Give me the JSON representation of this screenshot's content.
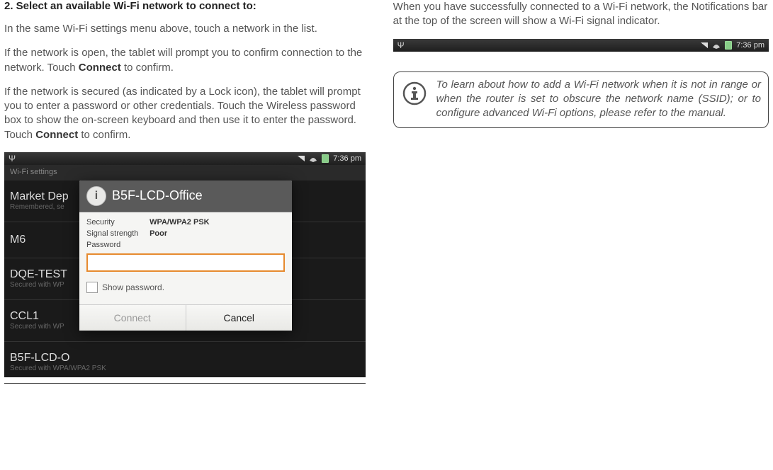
{
  "left": {
    "heading": "2.   Select an available Wi-Fi network to connect to:",
    "p1": "In the same Wi-Fi settings menu above, touch a network in the list.",
    "p2a": "If the network is open, the tablet will prompt you to confirm connection to the network. Touch ",
    "p2bold1": "Connect",
    "p2b": " to confirm.",
    "p3a": "If the network is secured (as indicated by a Lock icon), the tablet will prompt you to enter a password or other credentials.  Touch the Wireless password box to show the on-screen keyboard and then use it to enter the password. Touch ",
    "p3bold": "Connect",
    "p3b": " to confirm."
  },
  "screenshot": {
    "time": "7:36 pm",
    "wifi_settings_label": "Wi-Fi settings",
    "networks": [
      {
        "name": "Market Dep",
        "sub": "Remembered, se"
      },
      {
        "name": "M6",
        "sub": ""
      },
      {
        "name": "DQE-TEST",
        "sub": "Secured with WP"
      },
      {
        "name": "CCL1",
        "sub": "Secured with WP"
      },
      {
        "name": "B5F-LCD-O",
        "sub": "Secured with WPA/WPA2 PSK"
      }
    ],
    "dialog": {
      "title": "B5F-LCD-Office",
      "security_label": "Security",
      "security_value": "WPA/WPA2 PSK",
      "signal_label": "Signal strength",
      "signal_value": "Poor",
      "password_label": "Password",
      "show_pw": "Show password.",
      "connect": "Connect",
      "cancel": "Cancel"
    }
  },
  "right": {
    "p1": "When you have successfully connected to a Wi-Fi network, the Notifications bar at the top of the screen will show a Wi-Fi signal indicator.",
    "notif_time": "7:36 pm",
    "tip": "To learn about how to add a Wi-Fi network when it is not in range or when the router is set to obscure the network name (SSID); or to configure advanced Wi-Fi options, please refer to the manual."
  }
}
